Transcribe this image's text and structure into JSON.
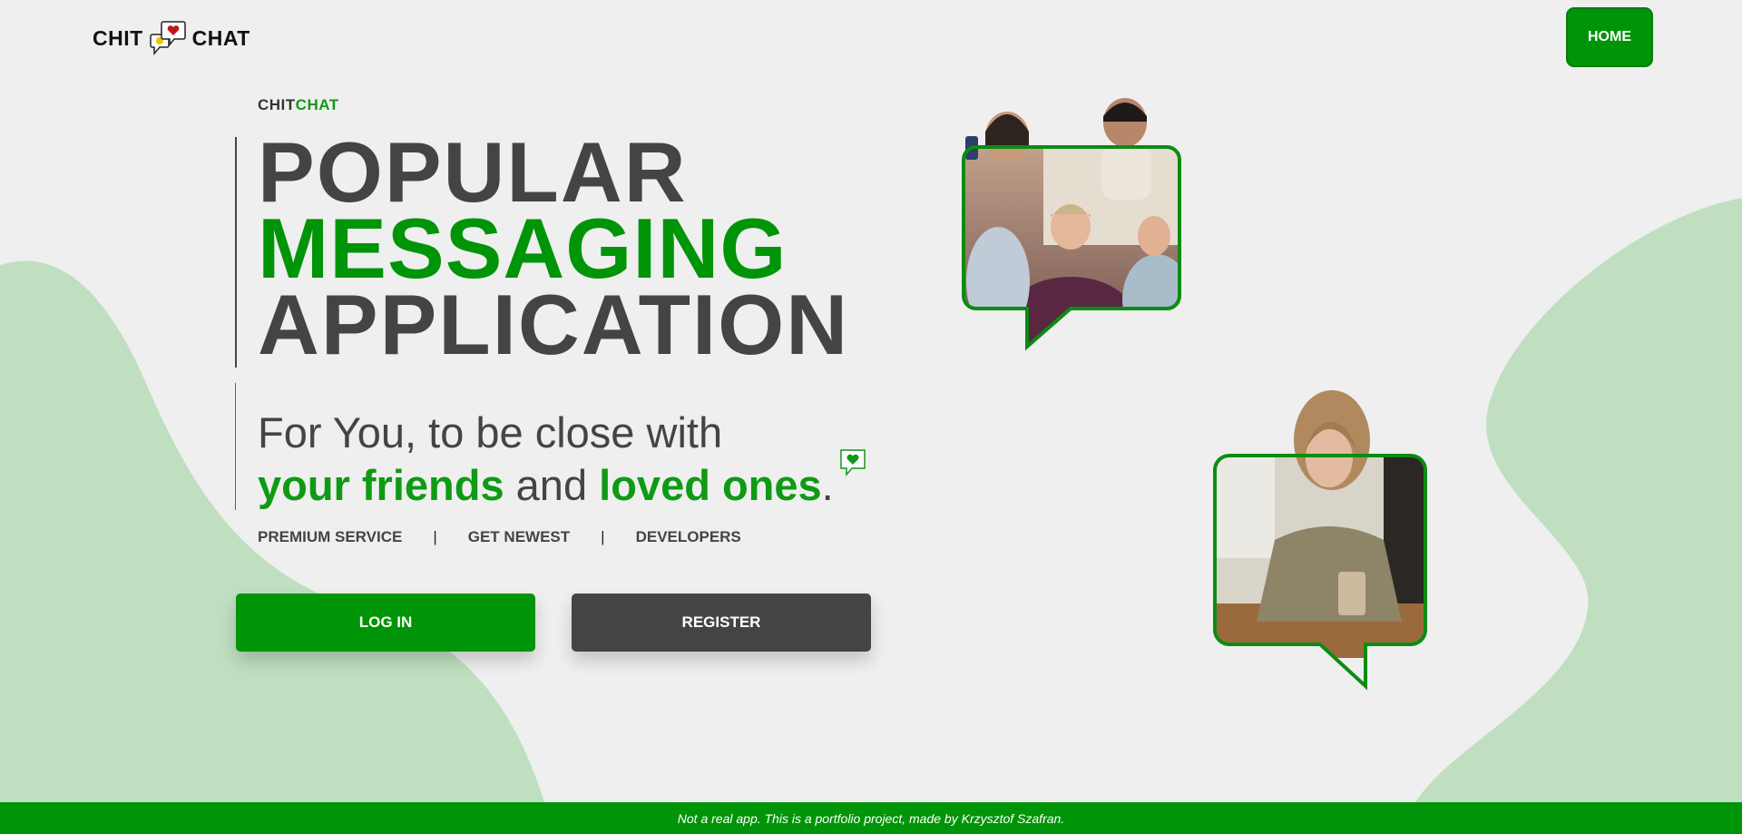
{
  "header": {
    "logo_left": "CHIT",
    "logo_right": "CHAT",
    "home_label": "HOME"
  },
  "hero": {
    "eyebrow_chit": "CHIT",
    "eyebrow_chat": "CHAT",
    "headline": [
      "POPULAR",
      "MESSAGING",
      "APPLICATION"
    ],
    "sub_line1": "For You, to be close with",
    "sub_friends": "your friends",
    "sub_and": " and ",
    "sub_loved": "loved ones",
    "sub_end": "."
  },
  "nav_links": [
    "PREMIUM SERVICE",
    "GET NEWEST",
    "DEVELOPERS"
  ],
  "separator": "|",
  "buttons": {
    "login": "LOG IN",
    "register": "REGISTER"
  },
  "footer": {
    "text": "Not a real app. This is a portfolio project, made by Krzysztof Szafran."
  },
  "colors": {
    "brand_green": "#009408",
    "dark": "#444444",
    "background": "#efefef",
    "blob": "#bfdfc0"
  },
  "icons": [
    "chat-bubbles-heart-icon",
    "heart-bubble-icon"
  ]
}
